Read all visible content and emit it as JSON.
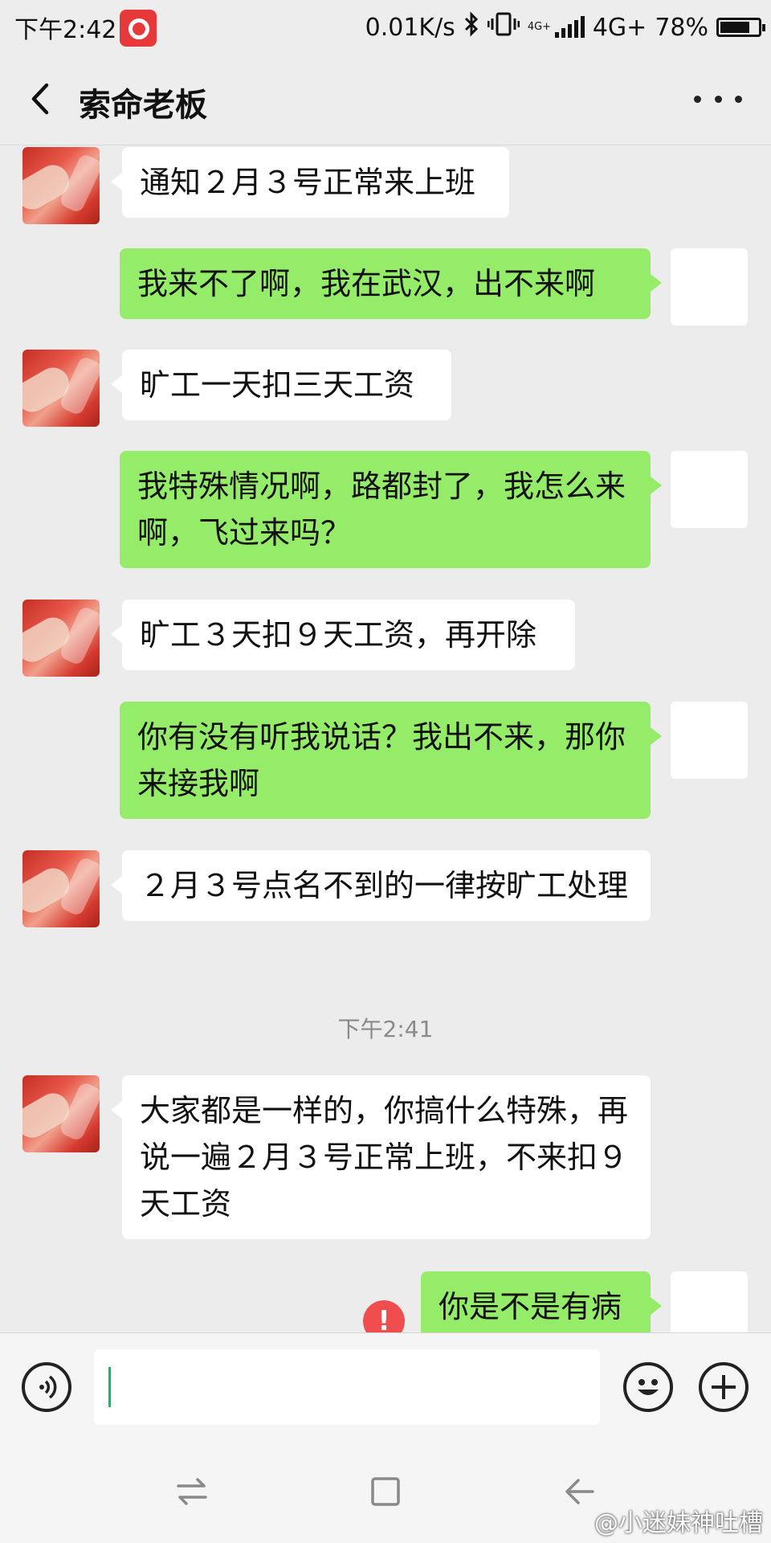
{
  "status_bar": {
    "time": "下午2:42",
    "net_speed": "0.01K/s",
    "network": "4G+",
    "network_small": "4G+",
    "battery": "78%",
    "battery_level": 0.78
  },
  "header": {
    "back_icon": "chevron-left-icon",
    "title": "索命老板",
    "more_icon": "more-dots-icon"
  },
  "messages": [
    {
      "side": "in",
      "text": "通知２月３号正常来上班"
    },
    {
      "side": "out",
      "text": "我来不了啊，我在武汉，出不来啊"
    },
    {
      "side": "in",
      "text": "旷工一天扣三天工资"
    },
    {
      "side": "out",
      "text": "我特殊情况啊，路都封了，我怎么来啊，飞过来吗？"
    },
    {
      "side": "in",
      "text": "旷工３天扣９天工资，再开除"
    },
    {
      "side": "out",
      "text": "你有没有听我说话？我出不来，那你来接我啊"
    },
    {
      "side": "in",
      "text": "２月３号点名不到的一律按旷工处理"
    },
    {
      "side": "in",
      "text": "大家都是一样的，你搞什么特殊，再说一遍２月３号正常上班，不来扣９天工资"
    },
    {
      "side": "out",
      "text": "你是不是有病",
      "failed": true,
      "error_mark": "!"
    }
  ],
  "timestamp": "下午2:41",
  "input_bar": {
    "voice_icon": "voice-icon",
    "emoji_icon": "emoji-icon",
    "plus_icon": "plus-icon",
    "value": ""
  },
  "system_nav": {
    "icons": [
      "switch-icon",
      "home-square-icon",
      "back-arrow-icon"
    ]
  },
  "watermark": "@小迷妹神吐槽"
}
